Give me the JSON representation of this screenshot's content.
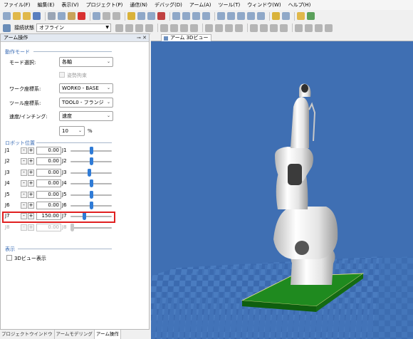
{
  "menu": [
    "ファイル(F)",
    "編集(E)",
    "表示(V)",
    "プロジェクト(P)",
    "通信(N)",
    "デバッグ(D)",
    "アーム(A)",
    "ツール(T)",
    "ウィンドウ(W)",
    "ヘルプ(H)"
  ],
  "toolbar": {
    "connection_label": "接続状態",
    "connection_value": "オフライン"
  },
  "panel": {
    "title": "アーム操作",
    "pin_icon": "pin-icon",
    "close_icon": "close-icon"
  },
  "operation_mode": {
    "section_title": "動作モード",
    "mode_label": "モード選択:",
    "mode_value": "各軸",
    "posture_label": "姿勢拘束",
    "work_coord_label": "ワーク座標系:",
    "work_coord_value": "WORK0 - BASE",
    "tool_coord_label": "ツール座標系:",
    "tool_coord_value": "TOOL0 - フランジ",
    "speed_label": "速度/インチング:",
    "speed_value": "速度",
    "percent_value": "10",
    "percent_unit": "%"
  },
  "robot_position": {
    "section_title": "ロボット位置",
    "minus_label": "-",
    "plus_label": "+",
    "joints": [
      {
        "label": "J1",
        "value": "0.00",
        "slider_level": 0.5,
        "enabled": true
      },
      {
        "label": "J2",
        "value": "0.00",
        "slider_level": 0.5,
        "enabled": true
      },
      {
        "label": "J3",
        "value": "0.00",
        "slider_level": 0.45,
        "enabled": true
      },
      {
        "label": "J4",
        "value": "0.00",
        "slider_level": 0.5,
        "enabled": true
      },
      {
        "label": "J5",
        "value": "0.00",
        "slider_level": 0.5,
        "enabled": true
      },
      {
        "label": "J6",
        "value": "0.00",
        "slider_level": 0.5,
        "enabled": true
      },
      {
        "label": "J7",
        "value": "150.00",
        "slider_level": 0.32,
        "enabled": true
      },
      {
        "label": "J8",
        "value": "0.00",
        "slider_level": 0.0,
        "enabled": false
      }
    ]
  },
  "display": {
    "section_title": "表示",
    "view3d_label": "3Dビュー表示"
  },
  "bottom_tabs": [
    "プロジェクトウインドウ",
    "アームモデリング",
    "アーム操作"
  ],
  "document_tab": "アーム 3Dビュー",
  "colors": {
    "viewport_bg": "#3f6fb3",
    "highlight": "#e02020",
    "slider_thumb": "#2f7bd6",
    "base_plate": "#1f8a1f"
  }
}
